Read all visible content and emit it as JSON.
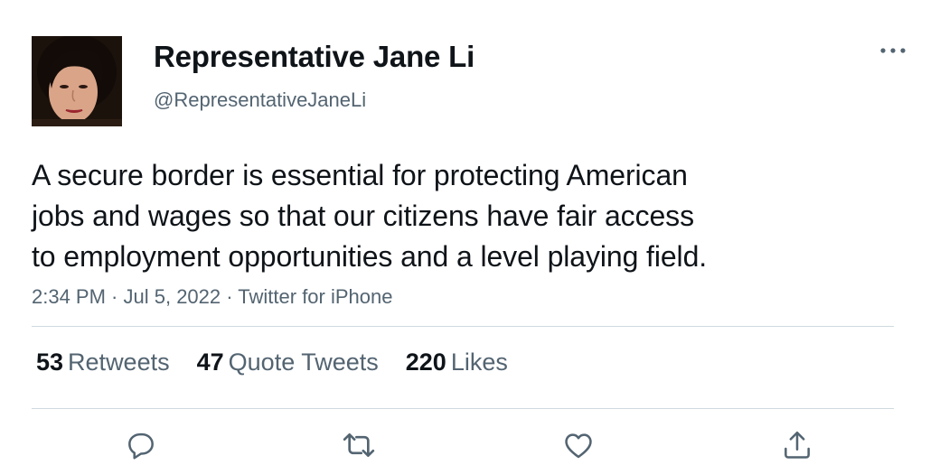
{
  "user": {
    "display_name": "Representative Jane Li",
    "handle": "@RepresentativeJaneLi",
    "avatar_icon": "profile-photo"
  },
  "tweet": {
    "text": "A secure border is essential for protecting American\njobs and wages so that our citizens have fair access\nto employment opportunities and a level playing field.",
    "time": "2:34 PM",
    "separator": " · ",
    "date": "Jul 5, 2022",
    "source": "Twitter for iPhone"
  },
  "stats": {
    "retweets": {
      "count": "53",
      "label": "Retweets"
    },
    "quotes": {
      "count": "47",
      "label": "Quote Tweets"
    },
    "likes": {
      "count": "220",
      "label": "Likes"
    }
  },
  "actions": {
    "reply_icon": "reply-icon",
    "retweet_icon": "retweet-icon",
    "like_icon": "heart-icon",
    "share_icon": "share-icon",
    "more_icon": "more-icon"
  },
  "colors": {
    "text": "#0f1419",
    "secondary": "#536471",
    "divider": "#cfd9de"
  }
}
